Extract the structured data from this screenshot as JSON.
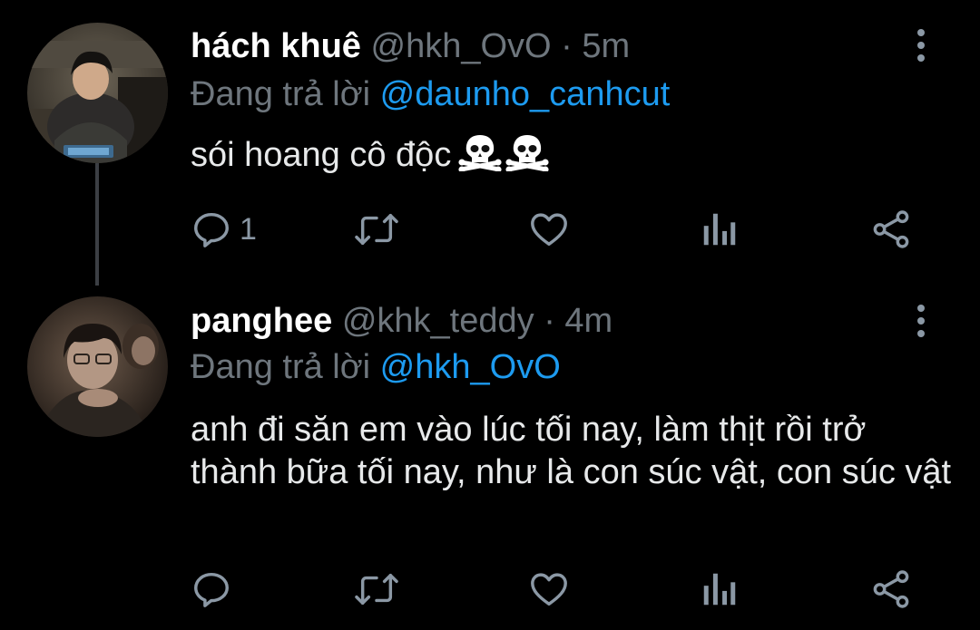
{
  "colors": {
    "background": "#000000",
    "text": "#e7e9ea",
    "muted": "#6e767d",
    "icon": "#8b98a5",
    "link": "#1d9bf0",
    "thread_line": "#3c3f44"
  },
  "tweets": [
    {
      "display_name": "hách khuê",
      "handle": "@hkh_OvO",
      "separator": "·",
      "time": "5m",
      "reply_prefix": "Đang trả lời",
      "reply_mention": "@daunho_canhcut",
      "text": "sói hoang cô độc",
      "emoji": "skull-and-crossbones x2",
      "reply_count": "1",
      "icons": [
        "reply-icon",
        "retweet-icon",
        "like-icon",
        "stats-icon",
        "share-icon",
        "more-icon"
      ]
    },
    {
      "display_name": "panghee",
      "handle": "@khk_teddy",
      "separator": "·",
      "time": "4m",
      "reply_prefix": "Đang trả lời",
      "reply_mention": "@hkh_OvO",
      "text": "anh đi săn em vào lúc tối nay, làm thịt rồi trở thành bữa tối nay, như là con súc vật, con súc vật",
      "reply_count": "",
      "icons": [
        "reply-icon",
        "retweet-icon",
        "like-icon",
        "stats-icon",
        "share-icon",
        "more-icon"
      ]
    }
  ]
}
